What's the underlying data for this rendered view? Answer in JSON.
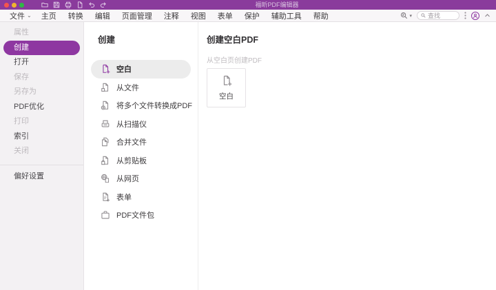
{
  "window": {
    "title": "福昕PDF编辑器"
  },
  "titlebar": {
    "traffic_lights": [
      "close",
      "minimize",
      "zoom"
    ],
    "quick_actions": [
      "open-folder",
      "save",
      "print",
      "new-document",
      "undo",
      "redo"
    ]
  },
  "menubar": {
    "items": [
      {
        "label": "文件",
        "caret": "⌄"
      },
      {
        "label": "主页"
      },
      {
        "label": "转换"
      },
      {
        "label": "编辑"
      },
      {
        "label": "页面管理"
      },
      {
        "label": "注释"
      },
      {
        "label": "视图"
      },
      {
        "label": "表单"
      },
      {
        "label": "保护"
      },
      {
        "label": "辅助工具"
      },
      {
        "label": "帮助"
      }
    ],
    "search": {
      "placeholder": "查找"
    }
  },
  "sidebar": {
    "items": [
      {
        "label": "属性",
        "state": "disabled"
      },
      {
        "label": "创建",
        "state": "selected"
      },
      {
        "label": "打开",
        "state": "normal"
      },
      {
        "label": "保存",
        "state": "disabled"
      },
      {
        "label": "另存为",
        "state": "disabled"
      },
      {
        "label": "PDF优化",
        "state": "normal"
      },
      {
        "label": "打印",
        "state": "disabled"
      },
      {
        "label": "索引",
        "state": "normal"
      },
      {
        "label": "关闭",
        "state": "disabled"
      }
    ],
    "footer_item": {
      "label": "偏好设置"
    }
  },
  "create_panel": {
    "title": "创建",
    "items": [
      {
        "label": "空白",
        "icon": "blank-doc",
        "selected": true
      },
      {
        "label": "从文件",
        "icon": "from-file"
      },
      {
        "label": "将多个文件转换成PDF",
        "icon": "convert-multiple"
      },
      {
        "label": "从扫描仪",
        "icon": "scanner"
      },
      {
        "label": "合并文件",
        "icon": "combine-files"
      },
      {
        "label": "从剪贴板",
        "icon": "clipboard"
      },
      {
        "label": "从网页",
        "icon": "webpage"
      },
      {
        "label": "表单",
        "icon": "form"
      },
      {
        "label": "PDF文件包",
        "icon": "pdf-portfolio"
      }
    ]
  },
  "detail_panel": {
    "title": "创建空白PDF",
    "subtitle": "从空白页创建PDF",
    "card": {
      "label": "空白",
      "icon": "blank-doc"
    }
  },
  "colors": {
    "titlebar": "#8a3b9c",
    "accent": "#8e37a1",
    "selected_pill": "#8e37a1"
  }
}
